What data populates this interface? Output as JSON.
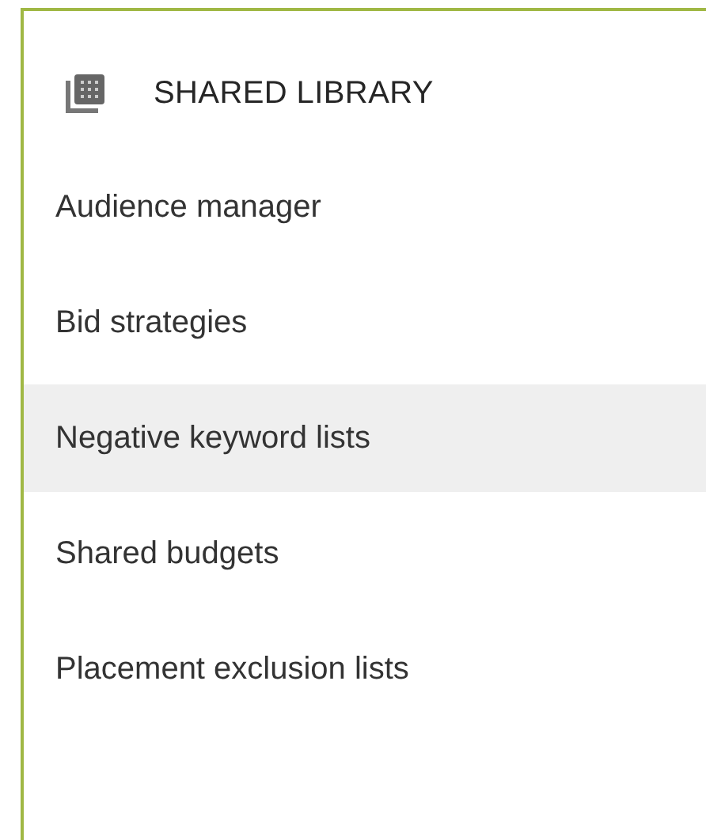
{
  "header": {
    "title": "SHARED LIBRARY"
  },
  "items": [
    {
      "label": "Audience manager",
      "selected": false
    },
    {
      "label": "Bid strategies",
      "selected": false
    },
    {
      "label": "Negative keyword lists",
      "selected": true
    },
    {
      "label": "Shared budgets",
      "selected": false
    },
    {
      "label": "Placement exclusion lists",
      "selected": false
    }
  ]
}
